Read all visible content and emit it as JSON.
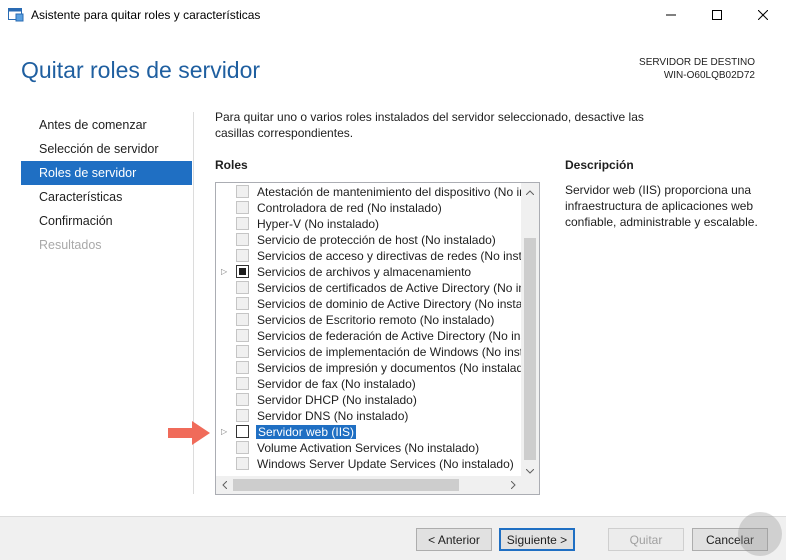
{
  "window": {
    "title": "Asistente para quitar roles y características",
    "icons": [
      "wizard-app-icon",
      "minimize-icon",
      "maximize-icon",
      "close-icon"
    ]
  },
  "header": {
    "page_title": "Quitar roles de servidor",
    "dest_label": "SERVIDOR DE DESTINO",
    "dest_server": "WIN-O60LQB02D72"
  },
  "nav": {
    "items": [
      {
        "label": "Antes de comenzar",
        "state": "normal"
      },
      {
        "label": "Selección de servidor",
        "state": "normal"
      },
      {
        "label": "Roles de servidor",
        "state": "active"
      },
      {
        "label": "Características",
        "state": "normal"
      },
      {
        "label": "Confirmación",
        "state": "normal"
      },
      {
        "label": "Resultados",
        "state": "disabled"
      }
    ]
  },
  "content": {
    "intro": "Para quitar uno o varios roles instalados del servidor seleccionado, desactive las casillas correspondientes.",
    "roles_heading": "Roles",
    "description_heading": "Descripción",
    "description_text": "Servidor web (IIS) proporciona una infraestructura de aplicaciones web confiable, administrable y escalable."
  },
  "roles": [
    {
      "label": "Atestación de mantenimiento del dispositivo (No in",
      "checkbox": "disabled",
      "expander": false,
      "selected": false
    },
    {
      "label": "Controladora de red (No instalado)",
      "checkbox": "disabled",
      "expander": false,
      "selected": false
    },
    {
      "label": "Hyper-V (No instalado)",
      "checkbox": "disabled",
      "expander": false,
      "selected": false
    },
    {
      "label": "Servicio de protección de host (No instalado)",
      "checkbox": "disabled",
      "expander": false,
      "selected": false
    },
    {
      "label": "Servicios de acceso y directivas de redes (No insta",
      "checkbox": "disabled",
      "expander": false,
      "selected": false
    },
    {
      "label": "Servicios de archivos y almacenamiento",
      "checkbox": "partial",
      "expander": true,
      "selected": false
    },
    {
      "label": "Servicios de certificados de Active Directory (No ins",
      "checkbox": "disabled",
      "expander": false,
      "selected": false
    },
    {
      "label": "Servicios de dominio de Active Directory (No insta",
      "checkbox": "disabled",
      "expander": false,
      "selected": false
    },
    {
      "label": "Servicios de Escritorio remoto (No instalado)",
      "checkbox": "disabled",
      "expander": false,
      "selected": false
    },
    {
      "label": "Servicios de federación de Active Directory (No ins",
      "checkbox": "disabled",
      "expander": false,
      "selected": false
    },
    {
      "label": "Servicios de implementación de Windows (No inst",
      "checkbox": "disabled",
      "expander": false,
      "selected": false
    },
    {
      "label": "Servicios de impresión y documentos (No instalad",
      "checkbox": "disabled",
      "expander": false,
      "selected": false
    },
    {
      "label": "Servidor de fax (No instalado)",
      "checkbox": "disabled",
      "expander": false,
      "selected": false
    },
    {
      "label": "Servidor DHCP (No instalado)",
      "checkbox": "disabled",
      "expander": false,
      "selected": false
    },
    {
      "label": "Servidor DNS (No instalado)",
      "checkbox": "disabled",
      "expander": false,
      "selected": false
    },
    {
      "label": "Servidor web (IIS)",
      "checkbox": "unchecked",
      "expander": true,
      "selected": true
    },
    {
      "label": "Volume Activation Services (No instalado)",
      "checkbox": "disabled",
      "expander": false,
      "selected": false
    },
    {
      "label": "Windows Server Update Services (No instalado)",
      "checkbox": "disabled",
      "expander": false,
      "selected": false
    }
  ],
  "buttons": {
    "prev": "< Anterior",
    "next": "Siguiente >",
    "install": "Quitar",
    "cancel": "Cancelar"
  },
  "colors": {
    "accent": "#1f6fc3",
    "title": "#1f5fa0",
    "pointer": "#f06b5a"
  }
}
